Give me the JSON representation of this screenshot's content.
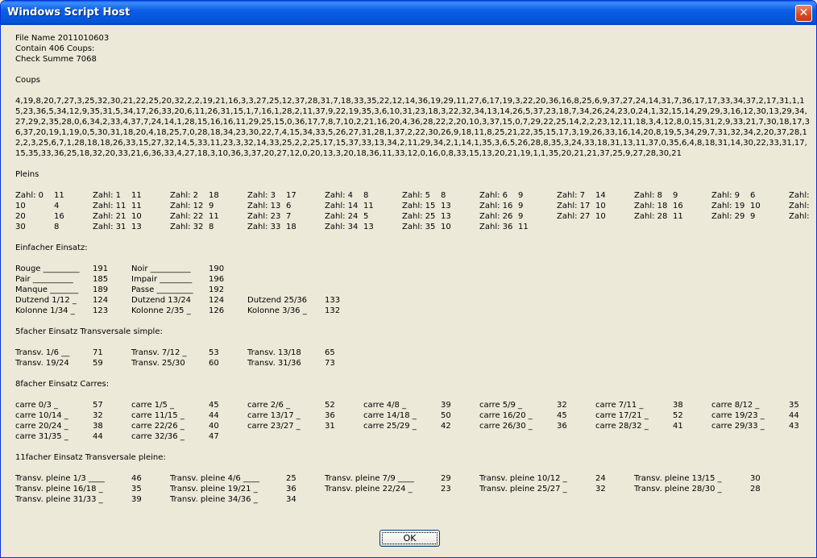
{
  "window": {
    "title": "Windows Script Host",
    "close_glyph": "✕",
    "ok_label": "OK"
  },
  "header": {
    "line1": "File Name 2011010603",
    "line2": "Contain 406 Coups:",
    "line3": "Check Summe 7068"
  },
  "coups": {
    "title": "Coups",
    "text": "4,19,8,20,7,27,3,25,32,30,21,22,25,20,32,2,2,19,21,16,3,3,27,25,12,37,28,31,7,18,33,35,22,12,14,36,19,29,11,27,6,17,19,3,22,20,36,16,8,25,6,9,37,27,24,14,31,7,36,17,17,33,34,37,2,17,31,1,15,23,36,5,34,12,9,35,31,5,34,17,26,33,20,6,11,26,31,15,1,7,16,1,28,2,11,37,9,22,19,35,3,6,10,31,23,18,3,22,32,34,13,14,26,5,37,23,18,7,34,26,24,23,0,24,1,32,15,14,29,29,3,16,12,30,13,29,34,27,29,2,35,28,0,6,34,2,33,4,37,7,24,14,1,28,15,16,16,11,29,25,15,0,36,17,7,8,7,10,2,21,16,20,4,36,28,22,2,20,10,3,37,15,0,7,29,22,25,14,2,2,23,12,11,18,3,4,12,8,0,15,31,2,9,33,21,7,30,18,17,36,37,20,19,1,19,0,5,30,31,18,20,4,18,25,7,0,28,18,34,23,30,22,7,4,15,34,33,5,26,27,31,28,1,37,2,22,30,26,9,18,11,8,25,21,22,35,15,17,3,19,26,33,16,14,20,8,19,5,34,29,7,31,32,34,2,20,37,28,12,2,3,25,6,7,1,28,18,18,26,33,15,27,32,14,5,33,11,23,3,32,14,33,25,2,2,25,17,15,37,33,13,34,2,11,29,34,2,1,14,1,35,3,6,5,26,28,8,35,3,24,33,18,31,13,11,37,0,35,6,4,8,18,31,14,30,22,33,31,17,15,35,33,36,25,18,32,20,33,21,6,36,33,4,27,18,3,10,36,3,37,20,27,12,0,20,13,3,20,18,36,11,33,12,0,16,0,8,33,15,13,20,21,19,1,1,35,20,21,21,37,25,9,27,28,30,21"
  },
  "pleins": {
    "title": "Pleins",
    "rows": [
      [
        [
          "Zahl: 0",
          "11"
        ],
        [
          "Zahl: 1",
          "11"
        ],
        [
          "Zahl: 2",
          "18"
        ],
        [
          "Zahl: 3",
          "17"
        ],
        [
          "Zahl: 4",
          "8"
        ],
        [
          "Zahl: 5",
          "8"
        ],
        [
          "Zahl: 6",
          "9"
        ],
        [
          "Zahl: 7",
          "14"
        ],
        [
          "Zahl: 8",
          "9"
        ],
        [
          "Zahl: 9",
          "6"
        ],
        [
          "Zahl:",
          ""
        ]
      ],
      [
        [
          "10",
          "4"
        ],
        [
          "Zahl: 11",
          "11"
        ],
        [
          "Zahl: 12",
          "9"
        ],
        [
          "Zahl: 13",
          "6"
        ],
        [
          "Zahl: 14",
          "11"
        ],
        [
          "Zahl: 15",
          "13"
        ],
        [
          "Zahl: 16",
          "9"
        ],
        [
          "Zahl: 17",
          "10"
        ],
        [
          "Zahl: 18",
          "16"
        ],
        [
          "Zahl: 19",
          "10"
        ],
        [
          "Zahl:",
          ""
        ]
      ],
      [
        [
          "20",
          "16"
        ],
        [
          "Zahl: 21",
          "10"
        ],
        [
          "Zahl: 22",
          "11"
        ],
        [
          "Zahl: 23",
          "7"
        ],
        [
          "Zahl: 24",
          "5"
        ],
        [
          "Zahl: 25",
          "13"
        ],
        [
          "Zahl: 26",
          "9"
        ],
        [
          "Zahl: 27",
          "10"
        ],
        [
          "Zahl: 28",
          "11"
        ],
        [
          "Zahl: 29",
          "9"
        ],
        [
          "Zahl:",
          ""
        ]
      ],
      [
        [
          "30",
          "8"
        ],
        [
          "Zahl: 31",
          "13"
        ],
        [
          "Zahl: 32",
          "8"
        ],
        [
          "Zahl: 33",
          "18"
        ],
        [
          "Zahl: 34",
          "13"
        ],
        [
          "Zahl: 35",
          "10"
        ],
        [
          "Zahl: 36",
          "11"
        ]
      ]
    ]
  },
  "einfach": {
    "title": "Einfacher Einsatz:",
    "rows": [
      [
        [
          "Rouge _________",
          "191"
        ],
        [
          "Noir __________",
          "190"
        ]
      ],
      [
        [
          "Pair __________",
          "185"
        ],
        [
          "Impair ________",
          "196"
        ]
      ],
      [
        [
          "Manque _______",
          "189"
        ],
        [
          "Passe _________",
          "192"
        ]
      ],
      [
        [
          "Dutzend 1/12 _",
          "124"
        ],
        [
          "Dutzend 13/24",
          "124"
        ],
        [
          "Dutzend 25/36",
          "133"
        ]
      ],
      [
        [
          "Kolonne 1/34 _",
          "123"
        ],
        [
          "Kolonne 2/35 _",
          "126"
        ],
        [
          "Kolonne 3/36 _",
          "132"
        ]
      ]
    ]
  },
  "simple": {
    "title": "5facher Einsatz Transversale simple:",
    "rows": [
      [
        [
          "Transv. 1/6 __",
          "71"
        ],
        [
          "Transv. 7/12 _",
          "53"
        ],
        [
          "Transv. 13/18",
          "65"
        ]
      ],
      [
        [
          "Transv. 19/24",
          "59"
        ],
        [
          "Transv. 25/30",
          "60"
        ],
        [
          "Transv. 31/36",
          "73"
        ]
      ]
    ]
  },
  "carres": {
    "title": "8facher Einsatz Carres:",
    "rows": [
      [
        [
          "carre 0/3 _",
          "57"
        ],
        [
          "carre 1/5 _",
          "45"
        ],
        [
          "carre 2/6 _",
          "52"
        ],
        [
          "carre 4/8 _",
          "39"
        ],
        [
          "carre 5/9 _",
          "32"
        ],
        [
          "carre 7/11 _",
          "38"
        ],
        [
          "carre 8/12 _",
          "35"
        ]
      ],
      [
        [
          "carre 10/14 _",
          "32"
        ],
        [
          "carre 11/15 _",
          "44"
        ],
        [
          "carre 13/17 _",
          "36"
        ],
        [
          "carre 14/18 _",
          "50"
        ],
        [
          "carre 16/20 _",
          "45"
        ],
        [
          "carre 17/21 _",
          "52"
        ],
        [
          "carre 19/23 _",
          "44"
        ]
      ],
      [
        [
          "carre 20/24 _",
          "38"
        ],
        [
          "carre 22/26 _",
          "40"
        ],
        [
          "carre 23/27 _",
          "31"
        ],
        [
          "carre 25/29 _",
          "42"
        ],
        [
          "carre 26/30 _",
          "36"
        ],
        [
          "carre 28/32 _",
          "41"
        ],
        [
          "carre 29/33 _",
          "43"
        ]
      ],
      [
        [
          "carre 31/35 _",
          "44"
        ],
        [
          "carre 32/36 _",
          "47"
        ]
      ]
    ]
  },
  "pleine": {
    "title": "11facher Einsatz Transversale pleine:",
    "rows": [
      [
        [
          "Transv. pleine 1/3 ____",
          "46"
        ],
        [
          "Transv. pleine 4/6 ____",
          "25"
        ],
        [
          "Transv. pleine 7/9 ____",
          "29"
        ],
        [
          "Transv. pleine 10/12 _",
          "24"
        ],
        [
          "Transv. pleine 13/15 _",
          "30"
        ]
      ],
      [
        [
          "Transv. pleine 16/18 _",
          "35"
        ],
        [
          "Transv. pleine 19/21 _",
          "36"
        ],
        [
          "Transv. pleine 22/24 _",
          "23"
        ],
        [
          "Transv. pleine 25/27 _",
          "32"
        ],
        [
          "Transv. pleine 28/30 _",
          "28"
        ]
      ],
      [
        [
          "Transv. pleine 31/33 _",
          "39"
        ],
        [
          "Transv. pleine 34/36 _",
          "34"
        ]
      ]
    ]
  }
}
